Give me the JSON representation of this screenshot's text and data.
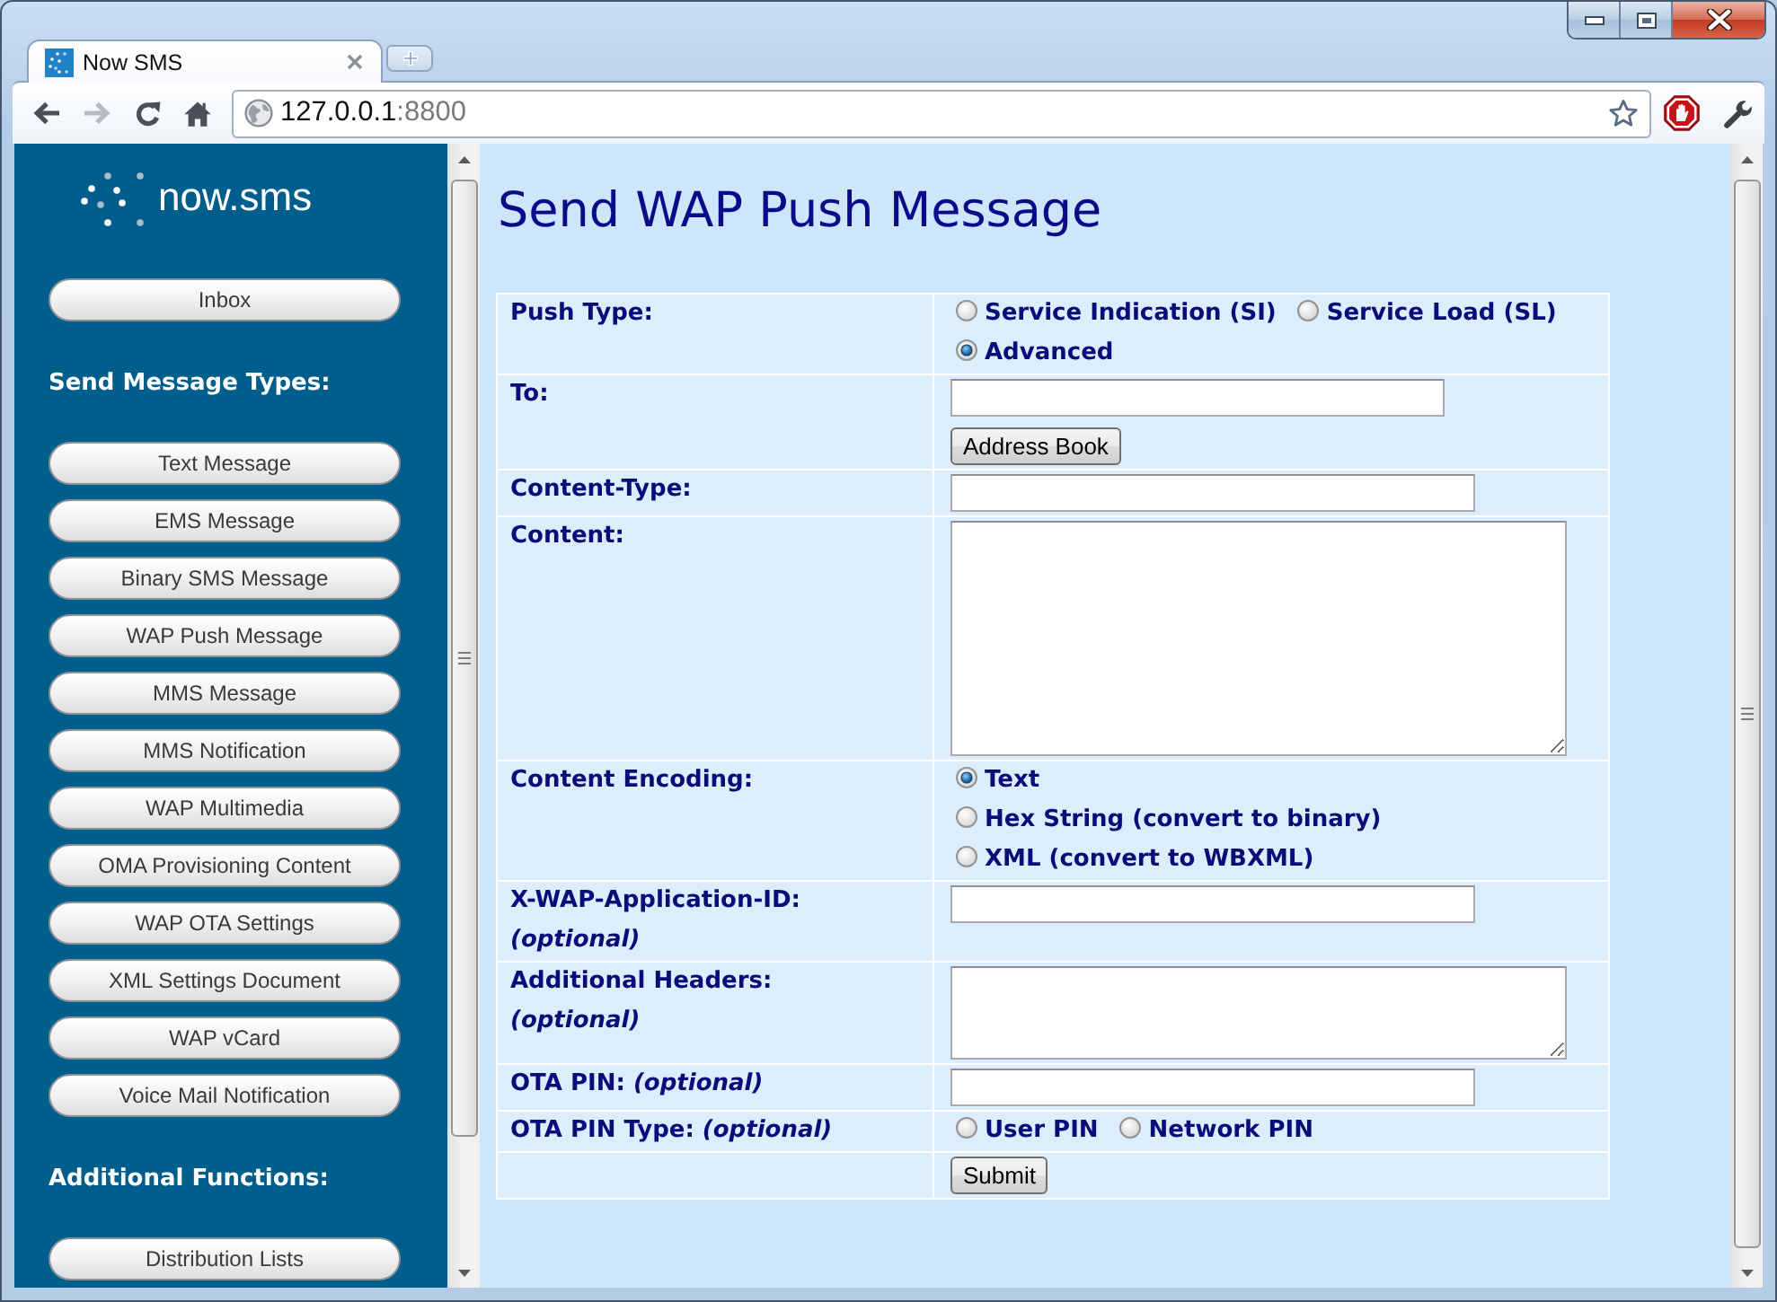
{
  "browser": {
    "tab": {
      "title": "Now SMS"
    },
    "toolbar": {
      "back": {
        "disabled": false
      },
      "forward": {
        "disabled": true
      }
    },
    "address": {
      "host": "127.0.0.1",
      "port": ":8800"
    }
  },
  "sidebar": {
    "logo": "now.sms",
    "buttons": [
      "Inbox"
    ],
    "sections": [
      {
        "heading": "Send Message Types:",
        "buttons": [
          "Text Message",
          "EMS Message",
          "Binary SMS Message",
          "WAP Push Message",
          "MMS Message",
          "MMS Notification",
          "WAP Multimedia",
          "OMA Provisioning Content",
          "WAP OTA Settings",
          "XML Settings Document",
          "WAP vCard",
          "Voice Mail Notification"
        ]
      },
      {
        "heading": "Additional Functions:",
        "buttons": [
          "Distribution Lists"
        ]
      }
    ]
  },
  "page": {
    "title": "Send WAP Push Message",
    "form": {
      "rows": [
        {
          "kind": "radio",
          "label": "Push Type:",
          "option_rows": [
            [
              {
                "label": "Service Indication (SI)",
                "selected": false
              },
              {
                "label": "Service Load (SL)",
                "selected": false
              }
            ],
            [
              {
                "label": "Advanced",
                "selected": true
              }
            ]
          ]
        },
        {
          "kind": "input",
          "label": "To:",
          "button": "Address Book"
        },
        {
          "kind": "input",
          "label": "Content-Type:"
        },
        {
          "kind": "textarea",
          "label": "Content:"
        },
        {
          "kind": "radio",
          "label": "Content Encoding:",
          "option_rows": [
            [
              {
                "label": "Text",
                "selected": true
              }
            ],
            [
              {
                "label": "Hex String (convert to binary)",
                "selected": false
              }
            ],
            [
              {
                "label": "XML (convert to WBXML)",
                "selected": false
              }
            ]
          ]
        },
        {
          "kind": "input",
          "label": "X-WAP-Application-ID: *(optional)*"
        },
        {
          "kind": "textarea",
          "label": "Additional Headers: *(optional)*"
        },
        {
          "kind": "input",
          "label": "OTA PIN: *(optional)*"
        },
        {
          "kind": "radio",
          "label": "OTA PIN Type: *(optional)*",
          "option_rows": [
            [
              {
                "label": "User PIN",
                "selected": false
              },
              {
                "label": "Network PIN",
                "selected": false
              }
            ]
          ]
        },
        {
          "kind": "submit",
          "button": "Submit"
        }
      ]
    }
  }
}
